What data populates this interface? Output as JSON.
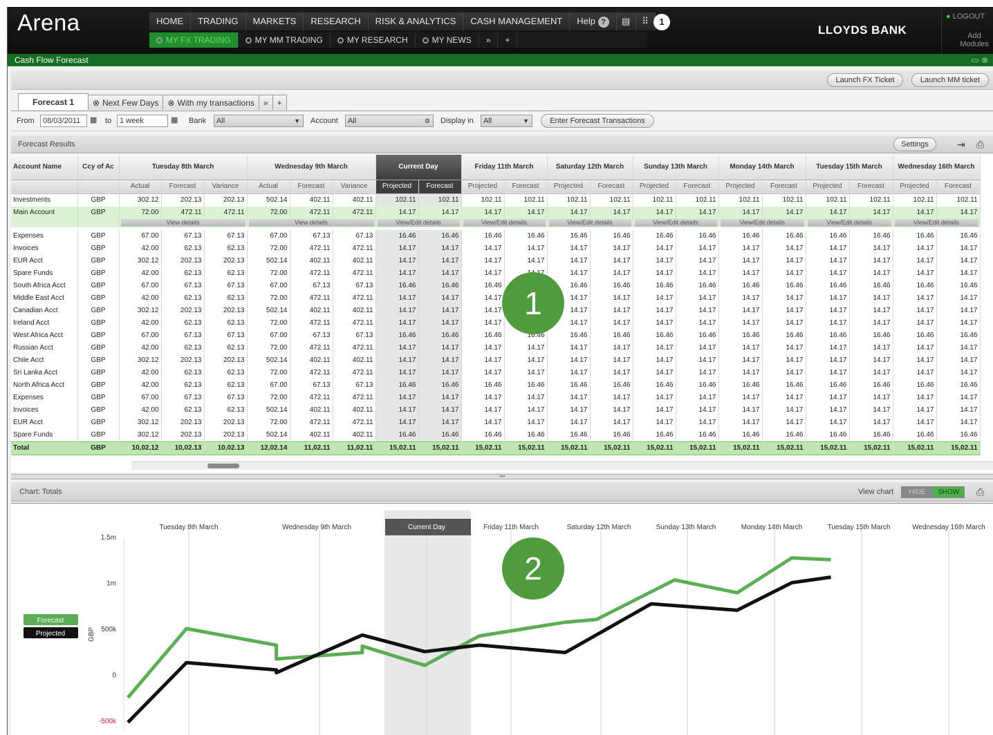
{
  "app": {
    "logo": "Arena",
    "bank": "LLOYDS BANK",
    "logout": "LOGOUT",
    "add_modules": "Add Modules",
    "notification_count": "1"
  },
  "nav": {
    "primary": [
      "HOME",
      "TRADING",
      "MARKETS",
      "RESEARCH",
      "RISK & ANALYTICS",
      "CASH MANAGEMENT",
      "Help"
    ],
    "tabs": [
      "MY FX TRADING",
      "MY MM TRADING",
      "MY RESEARCH",
      "MY NEWS"
    ]
  },
  "window": {
    "title": "Cash Flow Forecast",
    "launch_fx": "Launch FX Ticket",
    "launch_mm": "Launch MM ticket"
  },
  "forecast_tabs": [
    "Forecast 1",
    "Next Few Days",
    "With my transactions"
  ],
  "filters": {
    "from_label": "From",
    "from_value": "08/03/2011",
    "to_label": "to",
    "to_value": "1 week",
    "bank_label": "Bank",
    "bank_value": "All",
    "account_label": "Account",
    "account_value": "All",
    "display_label": "Display in",
    "display_value": "All",
    "enter_button": "Enter Forecast Transactions"
  },
  "results": {
    "title": "Forecast Results",
    "settings": "Settings"
  },
  "table": {
    "col_account": "Account Name",
    "col_ccy": "Ccy of Ac",
    "days": [
      {
        "name": "Tuesday 8th March",
        "subs": [
          "Actual",
          "Forecast",
          "Variance"
        ]
      },
      {
        "name": "Wednesday 9th March",
        "subs": [
          "Actual",
          "Forecast",
          "Variance"
        ]
      },
      {
        "name": "Current Day",
        "subs": [
          "Projected",
          "Forecast"
        ],
        "current": true
      },
      {
        "name": "Friday 11th March",
        "subs": [
          "Projected",
          "Forecast"
        ]
      },
      {
        "name": "Saturday 12th March",
        "subs": [
          "Projected",
          "Forecast"
        ]
      },
      {
        "name": "Sunday 13th March",
        "subs": [
          "Projected",
          "Forecast"
        ]
      },
      {
        "name": "Monday 14th March",
        "subs": [
          "Projected",
          "Forecast"
        ]
      },
      {
        "name": "Tuesday 15th March",
        "subs": [
          "Projected",
          "Forecast"
        ]
      },
      {
        "name": "Wednesday 16th March",
        "subs": [
          "Projected",
          "Forecast"
        ]
      }
    ],
    "view_details": "View details",
    "view_edit_details": "View/Edit details",
    "rows": [
      {
        "n": "Investments",
        "c": "GBP",
        "v": [
          "302.12",
          "202.13",
          "202.13",
          "502.14",
          "402.11",
          "402.11",
          "102.11",
          "102.11",
          "102.11",
          "102.11",
          "102.11",
          "102.11",
          "102.11",
          "102.11",
          "102.11",
          "102.11",
          "102.11",
          "102.11",
          "102.11",
          "102.11"
        ]
      },
      {
        "n": "Main Account",
        "c": "GBP",
        "main": true,
        "v": [
          "72.00",
          "472.11",
          "472.11",
          "72.00",
          "472.11",
          "472.11",
          "14.17",
          "14.17",
          "14.17",
          "14.17",
          "14.17",
          "14.17",
          "14.17",
          "14.17",
          "14.17",
          "14.17",
          "14.17",
          "14.17",
          "14.17",
          "14.17"
        ]
      },
      {
        "n": "Expenses",
        "c": "GBP",
        "v": [
          "67.00",
          "67.13",
          "67.13",
          "67.00",
          "67.13",
          "67.13",
          "16.46",
          "16.46",
          "16.46",
          "16.46",
          "16.46",
          "16.46",
          "16.46",
          "16.46",
          "16.46",
          "16.46",
          "16.46",
          "16.46",
          "16.46",
          "16.46"
        ]
      },
      {
        "n": "Invoices",
        "c": "GBP",
        "v": [
          "42.00",
          "62.13",
          "62.13",
          "72.00",
          "472.11",
          "472.11",
          "14.17",
          "14.17",
          "14.17",
          "14.17",
          "14.17",
          "14.17",
          "14.17",
          "14.17",
          "14.17",
          "14.17",
          "14.17",
          "14.17",
          "14.17",
          "14.17"
        ]
      },
      {
        "n": "EUR Acct",
        "c": "GBP",
        "v": [
          "302.12",
          "202.13",
          "202.13",
          "502.14",
          "402.11",
          "402.11",
          "14.17",
          "14.17",
          "14.17",
          "14.17",
          "14.17",
          "14.17",
          "14.17",
          "14.17",
          "14.17",
          "14.17",
          "14.17",
          "14.17",
          "14.17",
          "14.17"
        ]
      },
      {
        "n": "Spare Funds",
        "c": "GBP",
        "v": [
          "42.00",
          "62.13",
          "62.13",
          "72.00",
          "472.11",
          "472.11",
          "14.17",
          "14.17",
          "14.17",
          "14.17",
          "14.17",
          "14.17",
          "14.17",
          "14.17",
          "14.17",
          "14.17",
          "14.17",
          "14.17",
          "14.17",
          "14.17"
        ]
      },
      {
        "n": "South Africa Acct",
        "c": "GBP",
        "v": [
          "67.00",
          "67.13",
          "67.13",
          "67.00",
          "67.13",
          "67.13",
          "16.46",
          "16.46",
          "16.46",
          "16.46",
          "16.46",
          "16.46",
          "16.46",
          "16.46",
          "16.46",
          "16.46",
          "16.46",
          "16.46",
          "16.46",
          "16.46"
        ]
      },
      {
        "n": "Middle East Acct",
        "c": "GBP",
        "v": [
          "42.00",
          "62.13",
          "62.13",
          "72.00",
          "472.11",
          "472.11",
          "14.17",
          "14.17",
          "14.17",
          "14.17",
          "14.17",
          "14.17",
          "14.17",
          "14.17",
          "14.17",
          "14.17",
          "14.17",
          "14.17",
          "14.17",
          "14.17"
        ]
      },
      {
        "n": "Canadian Acct",
        "c": "GBP",
        "v": [
          "302.12",
          "202.13",
          "202.13",
          "502.14",
          "402.11",
          "402.11",
          "14.17",
          "14.17",
          "14.17",
          "14.17",
          "14.17",
          "14.17",
          "14.17",
          "14.17",
          "14.17",
          "14.17",
          "14.17",
          "14.17",
          "14.17",
          "14.17"
        ]
      },
      {
        "n": "Ireland Acct",
        "c": "GBP",
        "v": [
          "42.00",
          "62.13",
          "62.13",
          "72.00",
          "472.11",
          "472.11",
          "14.17",
          "14.17",
          "14.17",
          "14.17",
          "14.17",
          "14.17",
          "14.17",
          "14.17",
          "14.17",
          "14.17",
          "14.17",
          "14.17",
          "14.17",
          "14.17"
        ]
      },
      {
        "n": "West Africa Acct",
        "c": "GBP",
        "v": [
          "67.00",
          "67.13",
          "67.13",
          "67.00",
          "67.13",
          "67.13",
          "16.46",
          "16.46",
          "16.46",
          "16.46",
          "16.46",
          "16.46",
          "16.46",
          "16.46",
          "16.46",
          "16.46",
          "16.46",
          "16.46",
          "16.46",
          "16.46"
        ]
      },
      {
        "n": "Russian Acct",
        "c": "GBP",
        "v": [
          "42.00",
          "62.13",
          "62.13",
          "72.00",
          "472.11",
          "472.11",
          "14.17",
          "14.17",
          "14.17",
          "14.17",
          "14.17",
          "14.17",
          "14.17",
          "14.17",
          "14.17",
          "14.17",
          "14.17",
          "14.17",
          "14.17",
          "14.17"
        ]
      },
      {
        "n": "Chile Acct",
        "c": "GBP",
        "v": [
          "302.12",
          "202.13",
          "202.13",
          "502.14",
          "402.11",
          "402.11",
          "14.17",
          "14.17",
          "14.17",
          "14.17",
          "14.17",
          "14.17",
          "14.17",
          "14.17",
          "14.17",
          "14.17",
          "14.17",
          "14.17",
          "14.17",
          "14.17"
        ]
      },
      {
        "n": "Sri Lanka Acct",
        "c": "GBP",
        "v": [
          "42.00",
          "62.13",
          "62.13",
          "72.00",
          "472.11",
          "472.11",
          "14.17",
          "14.17",
          "14.17",
          "14.17",
          "14.17",
          "14.17",
          "14.17",
          "14.17",
          "14.17",
          "14.17",
          "14.17",
          "14.17",
          "14.17",
          "14.17"
        ]
      },
      {
        "n": "North Africa Acct",
        "c": "GBP",
        "v": [
          "42.00",
          "62.13",
          "62.13",
          "67.00",
          "67.13",
          "67.13",
          "16.46",
          "16.46",
          "16.46",
          "16.46",
          "16.46",
          "16.46",
          "16.46",
          "16.46",
          "16.46",
          "16.46",
          "16.46",
          "16.46",
          "16.46",
          "16.46"
        ]
      },
      {
        "n": "Expenses",
        "c": "GBP",
        "v": [
          "67.00",
          "67.13",
          "67.13",
          "72.00",
          "472.11",
          "472.11",
          "14.17",
          "14.17",
          "14.17",
          "14.17",
          "14.17",
          "14.17",
          "14.17",
          "14.17",
          "14.17",
          "14.17",
          "14.17",
          "14.17",
          "14.17",
          "14.17"
        ]
      },
      {
        "n": "Invoices",
        "c": "GBP",
        "v": [
          "42.00",
          "62.13",
          "62.13",
          "502.14",
          "402.11",
          "402.11",
          "14.17",
          "14.17",
          "14.17",
          "14.17",
          "14.17",
          "14.17",
          "14.17",
          "14.17",
          "14.17",
          "14.17",
          "14.17",
          "14.17",
          "14.17",
          "14.17"
        ]
      },
      {
        "n": "EUR Acct",
        "c": "GBP",
        "v": [
          "302.12",
          "202.13",
          "202.13",
          "72.00",
          "472.11",
          "472.11",
          "14.17",
          "14.17",
          "14.17",
          "14.17",
          "14.17",
          "14.17",
          "14.17",
          "14.17",
          "14.17",
          "14.17",
          "14.17",
          "14.17",
          "14.17",
          "14.17"
        ]
      },
      {
        "n": "Spare Funds",
        "c": "GBP",
        "v": [
          "302.12",
          "202.13",
          "202.13",
          "502.14",
          "402.11",
          "402.11",
          "16.46",
          "16.46",
          "16.46",
          "16.46",
          "16.46",
          "16.46",
          "16.46",
          "16.46",
          "16.46",
          "16.46",
          "16.46",
          "16.46",
          "16.46",
          "16.46"
        ]
      }
    ],
    "total": {
      "n": "Total",
      "c": "GBP",
      "v": [
        "10,02.12",
        "10,02.13",
        "10,02.13",
        "12,02.14",
        "11,02.11",
        "11,02.11",
        "15,02.11",
        "15,02.11",
        "15,02.11",
        "15,02.11",
        "15,02.11",
        "15,02.11",
        "15,02.11",
        "15,02.11",
        "15,02.11",
        "15,02.11",
        "15,02.11",
        "15,02.11",
        "15,02.11",
        "15,02.11"
      ]
    }
  },
  "chart_panel": {
    "title": "Chart: Totals",
    "view_chart_label": "View chart",
    "hide": "HIDE",
    "show": "SHOW"
  },
  "chart_data": {
    "type": "line",
    "categories": [
      "Tuesday 8th March",
      "Wednesday 9th March",
      "Current Day",
      "Friday 11th March",
      "Saturday 12th March",
      "Sunday 13th March",
      "Monday 14th March",
      "Tuesday 15th March",
      "Wednesday 16th March"
    ],
    "x": [
      0,
      0.5,
      1,
      1.5,
      2,
      2.5,
      3,
      3.5,
      4,
      4.5,
      5,
      5.5,
      6,
      6.5,
      7,
      7.5,
      8,
      8.5
    ],
    "series": [
      {
        "name": "Forecast",
        "color": "#5cae55",
        "values": [
          -250000,
          500000,
          320000,
          170000,
          240000,
          310000,
          100000,
          420000,
          570000,
          600000,
          1030000,
          890000,
          1270000,
          1250000
        ]
      },
      {
        "name": "Projected",
        "color": "#111111",
        "values": [
          -520000,
          130000,
          50000,
          20000,
          430000,
          250000,
          320000,
          240000,
          770000,
          700000,
          1000000,
          1060000
        ]
      }
    ],
    "forecast_x": [
      0,
      0.75,
      1.9,
      1.9,
      3.0,
      3.0,
      3.8,
      4.5,
      5.6,
      6,
      7,
      7.8,
      8.5,
      9
    ],
    "projected_x": [
      0,
      0.75,
      1.9,
      1.9,
      3.0,
      3.8,
      4.5,
      5.6,
      6.7,
      7.8,
      8.5,
      9
    ],
    "yticks": [
      "1.5m",
      "1m",
      "500k",
      "0",
      "-500k"
    ],
    "ylabel": "GBP",
    "ylim": [
      -500000,
      1500000
    ],
    "legend": [
      "Forecast",
      "Projected"
    ],
    "legend_position": "left",
    "highlight_category": "Current Day"
  },
  "markers": [
    "1",
    "2"
  ]
}
